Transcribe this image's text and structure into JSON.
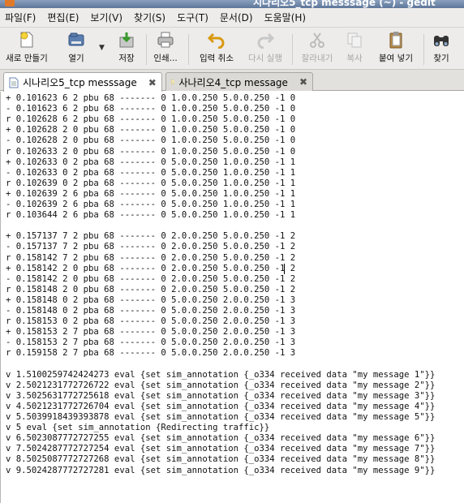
{
  "window": {
    "title": "시나리오5_tcp messsage (~) - gedit"
  },
  "menubar": {
    "items": [
      "파일(F)",
      "편집(E)",
      "보기(V)",
      "찾기(S)",
      "도구(T)",
      "문서(D)",
      "도움말(H)"
    ]
  },
  "toolbar": {
    "new": "새로 만들기",
    "open": "열기",
    "save": "저장",
    "print": "인쇄...",
    "undo": "입력 취소",
    "redo": "다시 실행",
    "cut": "잘라내기",
    "copy": "복사",
    "paste": "붙여 넣기",
    "find": "찾기"
  },
  "tabs": [
    {
      "label": "시나리오5_tcp messsage",
      "active": true
    },
    {
      "label": "사나리오4_tcp message",
      "active": false
    }
  ],
  "editor": {
    "lines": [
      "+ 0.101623 6 2 pbu 68 ------- 0 1.0.0.250 5.0.0.250 -1 0",
      "- 0.101623 6 2 pbu 68 ------- 0 1.0.0.250 5.0.0.250 -1 0",
      "r 0.102628 6 2 pbu 68 ------- 0 1.0.0.250 5.0.0.250 -1 0",
      "+ 0.102628 2 0 pbu 68 ------- 0 1.0.0.250 5.0.0.250 -1 0",
      "- 0.102628 2 0 pbu 68 ------- 0 1.0.0.250 5.0.0.250 -1 0",
      "r 0.102633 2 0 pbu 68 ------- 0 1.0.0.250 5.0.0.250 -1 0",
      "+ 0.102633 0 2 pba 68 ------- 0 5.0.0.250 1.0.0.250 -1 1",
      "- 0.102633 0 2 pba 68 ------- 0 5.0.0.250 1.0.0.250 -1 1",
      "r 0.102639 0 2 pba 68 ------- 0 5.0.0.250 1.0.0.250 -1 1",
      "+ 0.102639 2 6 pba 68 ------- 0 5.0.0.250 1.0.0.250 -1 1",
      "- 0.102639 2 6 pba 68 ------- 0 5.0.0.250 1.0.0.250 -1 1",
      "r 0.103644 2 6 pba 68 ------- 0 5.0.0.250 1.0.0.250 -1 1",
      "",
      "+ 0.157137 7 2 pbu 68 ------- 0 2.0.0.250 5.0.0.250 -1 2",
      "- 0.157137 7 2 pbu 68 ------- 0 2.0.0.250 5.0.0.250 -1 2",
      "r 0.158142 7 2 pbu 68 ------- 0 2.0.0.250 5.0.0.250 -1 2",
      "+ 0.158142 2 0 pbu 68 ------- 0 2.0.0.250 5.0.0.250 -1 2",
      "- 0.158142 2 0 pbu 68 ------- 0 2.0.0.250 5.0.0.250 -1 2",
      "r 0.158148 2 0 pbu 68 ------- 0 2.0.0.250 5.0.0.250 -1 2",
      "+ 0.158148 0 2 pba 68 ------- 0 5.0.0.250 2.0.0.250 -1 3",
      "- 0.158148 0 2 pba 68 ------- 0 5.0.0.250 2.0.0.250 -1 3",
      "r 0.158153 0 2 pba 68 ------- 0 5.0.0.250 2.0.0.250 -1 3",
      "+ 0.158153 2 7 pba 68 ------- 0 5.0.0.250 2.0.0.250 -1 3",
      "- 0.158153 2 7 pba 68 ------- 0 5.0.0.250 2.0.0.250 -1 3",
      "r 0.159158 2 7 pba 68 ------- 0 5.0.0.250 2.0.0.250 -1 3",
      "",
      "v 1.5100259742424273 eval {set sim_annotation {_o334 received data \"my message 1\"}}",
      "v 2.5021231772726722 eval {set sim_annotation {_o334 received data \"my message 2\"}}",
      "v 3.5025631772725618 eval {set sim_annotation {_o334 received data \"my message 3\"}}",
      "v 4.5021231772726704 eval {set sim_annotation {_o334 received data \"my message 4\"}}",
      "v 5.5039918439393878 eval {set sim_annotation {_o334 received data \"my message 5\"}}",
      "v 5 eval {set sim_annotation {Redirecting traffic}}",
      "v 6.5023087772727255 eval {set sim_annotation {_o334 received data \"my message 6\"}}",
      "v 7.5024287772727254 eval {set sim_annotation {_o334 received data \"my message 7\"}}",
      "v 8.5025087772727268 eval {set sim_annotation {_o334 received data \"my message 8\"}}",
      "v 9.5024287772727281 eval {set sim_annotation {_o334 received data \"my message 9\"}}"
    ]
  }
}
